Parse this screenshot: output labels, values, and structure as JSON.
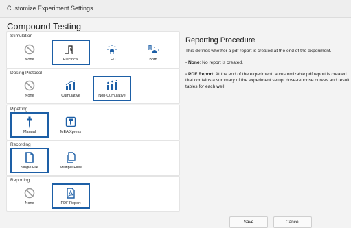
{
  "window": {
    "title": "Customize Experiment Settings"
  },
  "page_title": "Compound Testing",
  "groups": {
    "stimulation": {
      "label": "Stimulation",
      "options": [
        "None",
        "Electrical",
        "LED",
        "Both"
      ],
      "selected": "Electrical"
    },
    "dosing": {
      "label": "Dosing Protocol",
      "options": [
        "None",
        "Cumulative",
        "Non-Cumulative"
      ],
      "selected": "Non-Cumulative"
    },
    "pipetting": {
      "label": "Pipetting",
      "options": [
        "Manual",
        "MEA Xpress"
      ],
      "selected": "Manual"
    },
    "recording": {
      "label": "Recording",
      "options": [
        "Single File",
        "Multiple Files"
      ],
      "selected": "Single File"
    },
    "reporting": {
      "label": "Reporting",
      "options": [
        "None",
        "PDF Report"
      ],
      "selected": "PDF Report"
    }
  },
  "help": {
    "title": "Reporting Procedure",
    "intro": "This defines whether a pdf report is created at the end of the experiment.",
    "none_term": "- None",
    "none_text": ": No report is created.",
    "pdf_term": "- PDF Report",
    "pdf_text": ": At the end of the experiment, a customizable pdf report is created that contains a summary of the experiment setup, dose-reponse curves and result tables for each well."
  },
  "buttons": {
    "save": "Save",
    "cancel": "Cancel"
  },
  "colors": {
    "accent": "#1d5fa6",
    "icon": "#1d5fa6",
    "disabled": "#9a9a9a"
  },
  "icons": {
    "none": "prohibited-icon",
    "electrical": "pulse-icon",
    "led": "led-icon",
    "both": "pulse-led-icon",
    "cumulative": "cumulative-bars-icon",
    "non_cumulative": "non-cumulative-bars-icon",
    "manual": "pipette-icon",
    "mea_xpress": "mea-xpress-icon",
    "single_file": "single-file-icon",
    "multiple_files": "multiple-files-icon",
    "pdf": "pdf-report-icon"
  }
}
